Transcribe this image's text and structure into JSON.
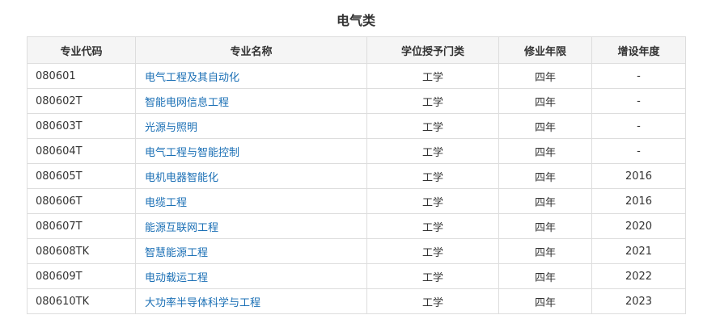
{
  "title": "电气类",
  "table": {
    "headers": [
      "专业代码",
      "专业名称",
      "学位授予门类",
      "修业年限",
      "增设年度"
    ],
    "rows": [
      {
        "code": "080601",
        "name": "电气工程及其自动化",
        "degree": "工学",
        "duration": "四年",
        "year": "-"
      },
      {
        "code": "080602T",
        "name": "智能电网信息工程",
        "degree": "工学",
        "duration": "四年",
        "year": "-"
      },
      {
        "code": "080603T",
        "name": "光源与照明",
        "degree": "工学",
        "duration": "四年",
        "year": "-"
      },
      {
        "code": "080604T",
        "name": "电气工程与智能控制",
        "degree": "工学",
        "duration": "四年",
        "year": "-"
      },
      {
        "code": "080605T",
        "name": "电机电器智能化",
        "degree": "工学",
        "duration": "四年",
        "year": "2016"
      },
      {
        "code": "080606T",
        "name": "电缆工程",
        "degree": "工学",
        "duration": "四年",
        "year": "2016"
      },
      {
        "code": "080607T",
        "name": "能源互联网工程",
        "degree": "工学",
        "duration": "四年",
        "year": "2020"
      },
      {
        "code": "080608TK",
        "name": "智慧能源工程",
        "degree": "工学",
        "duration": "四年",
        "year": "2021"
      },
      {
        "code": "080609T",
        "name": "电动载运工程",
        "degree": "工学",
        "duration": "四年",
        "year": "2022"
      },
      {
        "code": "080610TK",
        "name": "大功率半导体科学与工程",
        "degree": "工学",
        "duration": "四年",
        "year": "2023"
      }
    ]
  },
  "colors": {
    "link": "#1a6fb5",
    "border": "#dddddd",
    "header_bg": "#f5f5f5"
  }
}
